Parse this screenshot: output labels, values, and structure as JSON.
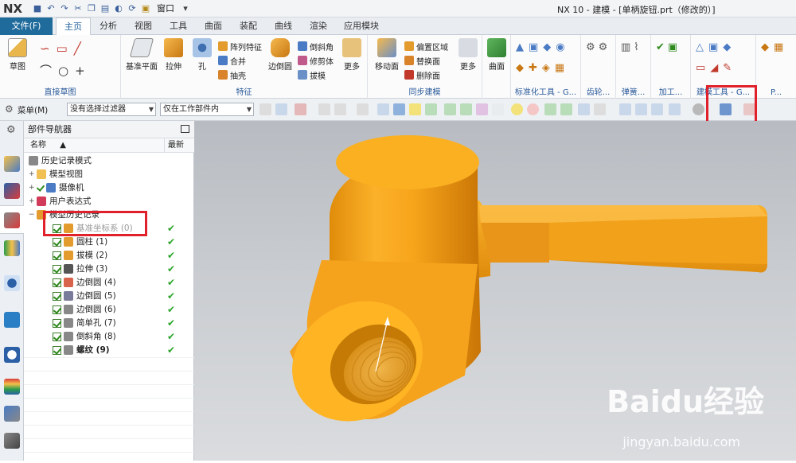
{
  "app": {
    "logo": "NX",
    "window_title": "NX 10 - 建模 - [单柄旋钮.prt（修改的）]",
    "window_menu": "窗口"
  },
  "tabs": {
    "file": "文件(F)",
    "items": [
      "主页",
      "分析",
      "视图",
      "工具",
      "曲面",
      "装配",
      "曲线",
      "渲染",
      "应用模块"
    ],
    "active": "主页"
  },
  "ribbon": {
    "sketch_group": {
      "label": "直接草图",
      "sketch": "草图"
    },
    "feature_group": {
      "label": "特征",
      "datum_plane": "基准平面",
      "extrude": "拉伸",
      "hole": "孔",
      "pattern": "阵列特征",
      "unite": "合并",
      "shell": "抽壳",
      "edge_blend": "边倒圆",
      "chamfer": "倒斜角",
      "trim_body": "修剪体",
      "draft": "拔模",
      "more": "更多"
    },
    "sync_group": {
      "label": "同步建模",
      "move_face": "移动面",
      "offset_region": "偏置区域",
      "replace_face": "替换面",
      "delete_face": "删除面",
      "more": "更多"
    },
    "surface": {
      "label": "曲面"
    },
    "std_tools": {
      "label": "标准化工具 - G..."
    },
    "gear": {
      "label": "齿轮..."
    },
    "spring": {
      "label": "弹簧..."
    },
    "machining": {
      "label": "加工..."
    },
    "modeling_tools": {
      "label": "建模工具 - G..."
    },
    "more_label": "P..."
  },
  "toolbar": {
    "menu": "菜单(M)",
    "filter": "没有选择过滤器",
    "scope": "仅在工作部件内"
  },
  "navigator": {
    "title": "部件导航器",
    "col_name": "名称",
    "col_latest": "最新",
    "rows": [
      {
        "label": "历史记录模式",
        "type": "top"
      },
      {
        "label": "模型视图",
        "type": "group"
      },
      {
        "label": "摄像机",
        "type": "group"
      },
      {
        "label": "用户表达式",
        "type": "group"
      },
      {
        "label": "模型历史记录",
        "type": "group-open"
      },
      {
        "label": "基准坐标系 (0)",
        "type": "feat",
        "dim": true,
        "ok": true
      },
      {
        "label": "圆柱 (1)",
        "type": "feat",
        "ok": true
      },
      {
        "label": "拔模 (2)",
        "type": "feat",
        "ok": true
      },
      {
        "label": "拉伸 (3)",
        "type": "feat",
        "ok": true
      },
      {
        "label": "边倒圆 (4)",
        "type": "feat",
        "ok": true
      },
      {
        "label": "边倒圆 (5)",
        "type": "feat",
        "ok": true
      },
      {
        "label": "边倒圆 (6)",
        "type": "feat",
        "ok": true
      },
      {
        "label": "简单孔 (7)",
        "type": "feat",
        "ok": true
      },
      {
        "label": "倒斜角 (8)",
        "type": "feat",
        "ok": true
      },
      {
        "label": "螺纹 (9)",
        "type": "feat",
        "bold": true,
        "ok": true
      }
    ]
  },
  "watermark": {
    "brand": "Baidu经验",
    "url": "jingyan.baidu.com"
  },
  "colors": {
    "part": "#f6a21a",
    "part_dark": "#d9830a",
    "accent": "#1f6b9c",
    "highlight": "#e0212b"
  }
}
